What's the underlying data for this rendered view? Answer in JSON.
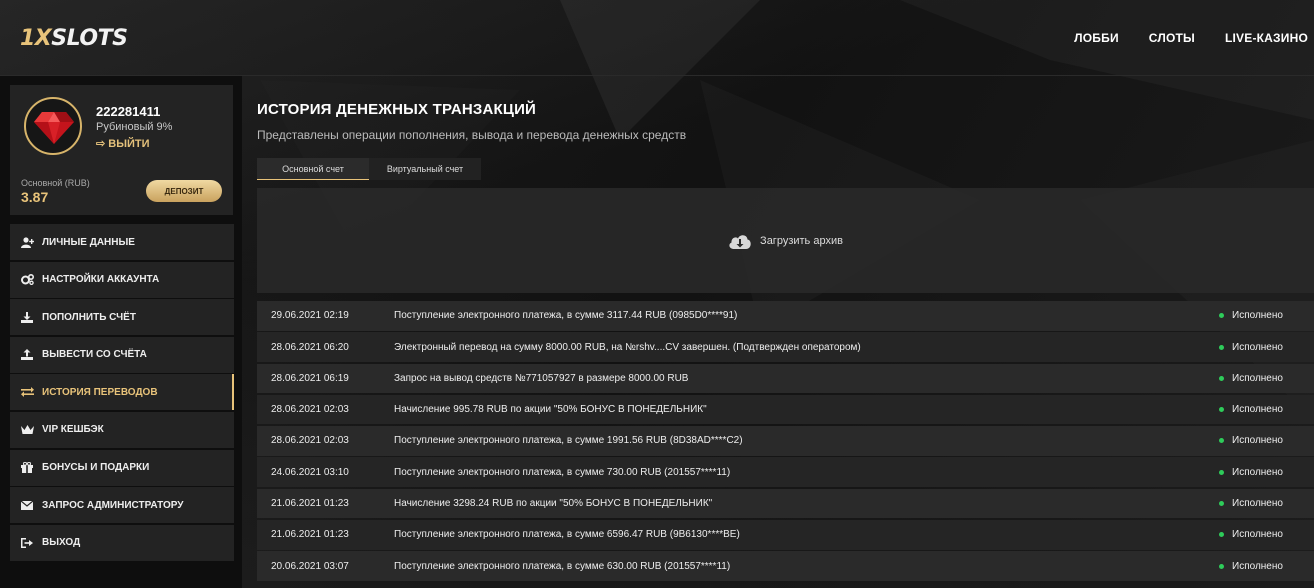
{
  "brand": {
    "logo_prefix": "1X",
    "logo_suffix": "SLOTS",
    "accent": "#e8c37a"
  },
  "nav": {
    "items": [
      {
        "label": "ЛОББИ"
      },
      {
        "label": "СЛОТЫ"
      },
      {
        "label": "LIVE-КАЗИНО"
      }
    ]
  },
  "profile": {
    "user_id": "222281411",
    "level": "Рубиновый 9%",
    "logout_label": "ВЫЙТИ",
    "balance_label": "Основной (RUB)",
    "balance_value": "3.87",
    "deposit_label": "ДЕПОЗИТ",
    "avatar_icon": "ruby-icon"
  },
  "menu": {
    "items": [
      {
        "label": "ЛИЧНЫЕ ДАННЫЕ",
        "icon": "user-plus-icon"
      },
      {
        "label": "НАСТРОЙКИ АККАУНТА",
        "icon": "gears-icon"
      },
      {
        "label": "ПОПОЛНИТЬ СЧЁТ",
        "icon": "download-icon"
      },
      {
        "label": "ВЫВЕСТИ СО СЧЁТА",
        "icon": "upload-icon"
      },
      {
        "label": "ИСТОРИЯ ПЕРЕВОДОВ",
        "icon": "transfer-icon",
        "active": true
      },
      {
        "label": "VIP КЕШБЭК",
        "icon": "crown-icon"
      },
      {
        "label": "БОНУСЫ И ПОДАРКИ",
        "icon": "gift-icon"
      },
      {
        "label": "ЗАПРОС АДМИНИСТРАТОРУ",
        "icon": "envelope-icon"
      },
      {
        "label": "ВЫХОД",
        "icon": "sign-out-icon"
      }
    ]
  },
  "page": {
    "title": "ИСТОРИЯ ДЕНЕЖНЫХ ТРАНЗАКЦИЙ",
    "subtitle": "Представлены операции пополнения, вывода и перевода денежных средств",
    "tabs": [
      {
        "label": "Основной счет",
        "active": true
      },
      {
        "label": "Виртуальный счет",
        "active": false
      }
    ],
    "archive_label": "Загрузить архив"
  },
  "transactions": [
    {
      "date": "29.06.2021 02:19",
      "description": "Поступление электронного платежа, в сумме 3117.44 RUB (0985D0****91)",
      "status": "Исполнено"
    },
    {
      "date": "28.06.2021 06:20",
      "description": "Электронный перевод на сумму 8000.00 RUB, на №rshv....CV завершен. (Подтвержден оператором)",
      "status": "Исполнено"
    },
    {
      "date": "28.06.2021 06:19",
      "description": "Запрос на вывод средств №771057927 в размере 8000.00 RUB",
      "status": "Исполнено"
    },
    {
      "date": "28.06.2021 02:03",
      "description": "Начисление 995.78 RUB по акции \"50% БОНУС В ПОНЕДЕЛЬНИК\"",
      "status": "Исполнено"
    },
    {
      "date": "28.06.2021 02:03",
      "description": "Поступление электронного платежа, в сумме 1991.56 RUB (8D38AD****C2)",
      "status": "Исполнено"
    },
    {
      "date": "24.06.2021 03:10",
      "description": "Поступление электронного платежа, в сумме 730.00 RUB (201557****11)",
      "status": "Исполнено"
    },
    {
      "date": "21.06.2021 01:23",
      "description": "Начисление 3298.24 RUB по акции \"50% БОНУС В ПОНЕДЕЛЬНИК\"",
      "status": "Исполнено"
    },
    {
      "date": "21.06.2021 01:23",
      "description": "Поступление электронного платежа, в сумме 6596.47 RUB (9B6130****BE)",
      "status": "Исполнено"
    },
    {
      "date": "20.06.2021 03:07",
      "description": "Поступление электронного платежа, в сумме 630.00 RUB (201557****11)",
      "status": "Исполнено"
    }
  ]
}
